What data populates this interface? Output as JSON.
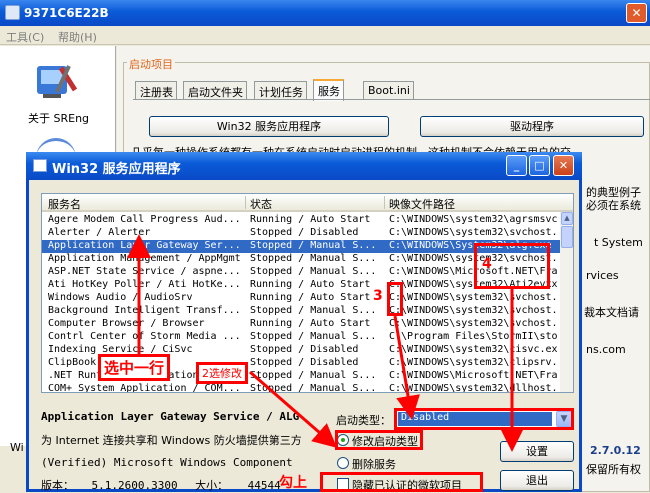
{
  "outer_window": {
    "title": "9371C6E22B",
    "close_glyph": "✕",
    "menu": [
      "工具(C)",
      "帮助(H)"
    ]
  },
  "sidebar": {
    "about_label": "关于 SREng"
  },
  "main": {
    "group_label": "启动项目",
    "tabs": [
      "注册表",
      "启动文件夹",
      "计划任务",
      "服务",
      "Boot.ini"
    ],
    "selected_tab": "服务",
    "btn_win32": "Win32 服务应用程序",
    "btn_driver": "驱动程序",
    "bg_text_line1": "几乎每一种操作系统都有一种在系统启动时启动进程的机制，这种机制不会依赖于用户的交",
    "bg_text_right": [
      "的典型例子",
      "必须在系统",
      "t System",
      "rvices",
      "裁本文档请",
      "ns.com"
    ],
    "version_partial": "2.7.0.12",
    "rights_partial": "保留所有权",
    "wi_partial": "Wi"
  },
  "dialog": {
    "title": "Win32 服务应用程序",
    "min_glyph": "_",
    "max_glyph": "□",
    "close_glyph": "✕",
    "columns": [
      "服务名",
      "状态",
      "映像文件路径"
    ],
    "rows": [
      {
        "name": "Agere Modem Call Progress Aud...",
        "status": "Running / Auto Start",
        "path": "C:\\WINDOWS\\system32\\agrsmsvc"
      },
      {
        "name": "Alerter / Alerter",
        "status": "Stopped / Disabled",
        "path": "C:\\WINDOWS\\system32\\svchost."
      },
      {
        "name": "Application Layer Gateway Ser...",
        "status": "Stopped / Manual S...",
        "path": "C:\\WINDOWS\\System32\\alg.exe"
      },
      {
        "name": "Application Management / AppMgmt",
        "status": "Stopped / Manual S...",
        "path": "C:\\WINDOWS\\system32\\svchost."
      },
      {
        "name": "ASP.NET State Service / aspne...",
        "status": "Stopped / Manual S...",
        "path": "C:\\WINDOWS\\Microsoft.NET\\Fra"
      },
      {
        "name": "Ati HotKey Poller / Ati HotKe...",
        "status": "Running / Auto Start",
        "path": "C:\\WINDOWS\\system32\\Ati2evxx"
      },
      {
        "name": "Windows Audio / AudioSrv",
        "status": "Running / Auto Start",
        "path": "C:\\WINDOWS\\system32\\svchost."
      },
      {
        "name": "Background Intelligent Transf...",
        "status": "Stopped / Manual S...",
        "path": "C:\\WINDOWS\\system32\\svchost."
      },
      {
        "name": "Computer Browser / Browser",
        "status": "Running / Auto Start",
        "path": "C:\\WINDOWS\\system32\\svchost."
      },
      {
        "name": "Contrl Center of Storm Media ...",
        "status": "Stopped / Manual S...",
        "path": "C:\\Program Files\\StormII\\sto"
      },
      {
        "name": "Indexing Service / CiSvc",
        "status": "Stopped / Disabled",
        "path": "C:\\WINDOWS\\system32\\cisvc.ex"
      },
      {
        "name": "ClipBook / ClipSrv",
        "status": "Stopped / Disabled",
        "path": "C:\\WINDOWS\\system32\\clipsrv."
      },
      {
        "name": ".NET Runtime Optimization Ser...",
        "status": "Stopped / Manual S...",
        "path": "C:\\WINDOWS\\Microsoft.NET\\Fra"
      },
      {
        "name": "COM+ System Application / COM...",
        "status": "Stopped / Manual S...",
        "path": "C:\\WINDOWS\\system32\\dllhost."
      }
    ],
    "selected_row_index": 2,
    "selected_service": "Application Layer Gateway Service / ALG",
    "description": "为 Internet 连接共享和 Windows 防火墙提供第三方",
    "company": "(Verified) Microsoft Windows Component",
    "version_label": "版本：",
    "version_value": "5.1.2600.3300",
    "size_label": "大小：",
    "size_value": "44544",
    "start_type_label": "启动类型：",
    "start_type_value": "Disabled",
    "radio_modify": "修改启动类型",
    "radio_delete": "删除服务",
    "hide_ms_checkbox": "隐藏已认证的微软项目",
    "btn_settings": "设置",
    "btn_exit": "退出"
  },
  "annotations": {
    "select_row": "选中一行",
    "choose_modify": "2选修改",
    "step3": "3",
    "step4": "4",
    "check_it": "勾上",
    "color": "#ff0000"
  }
}
